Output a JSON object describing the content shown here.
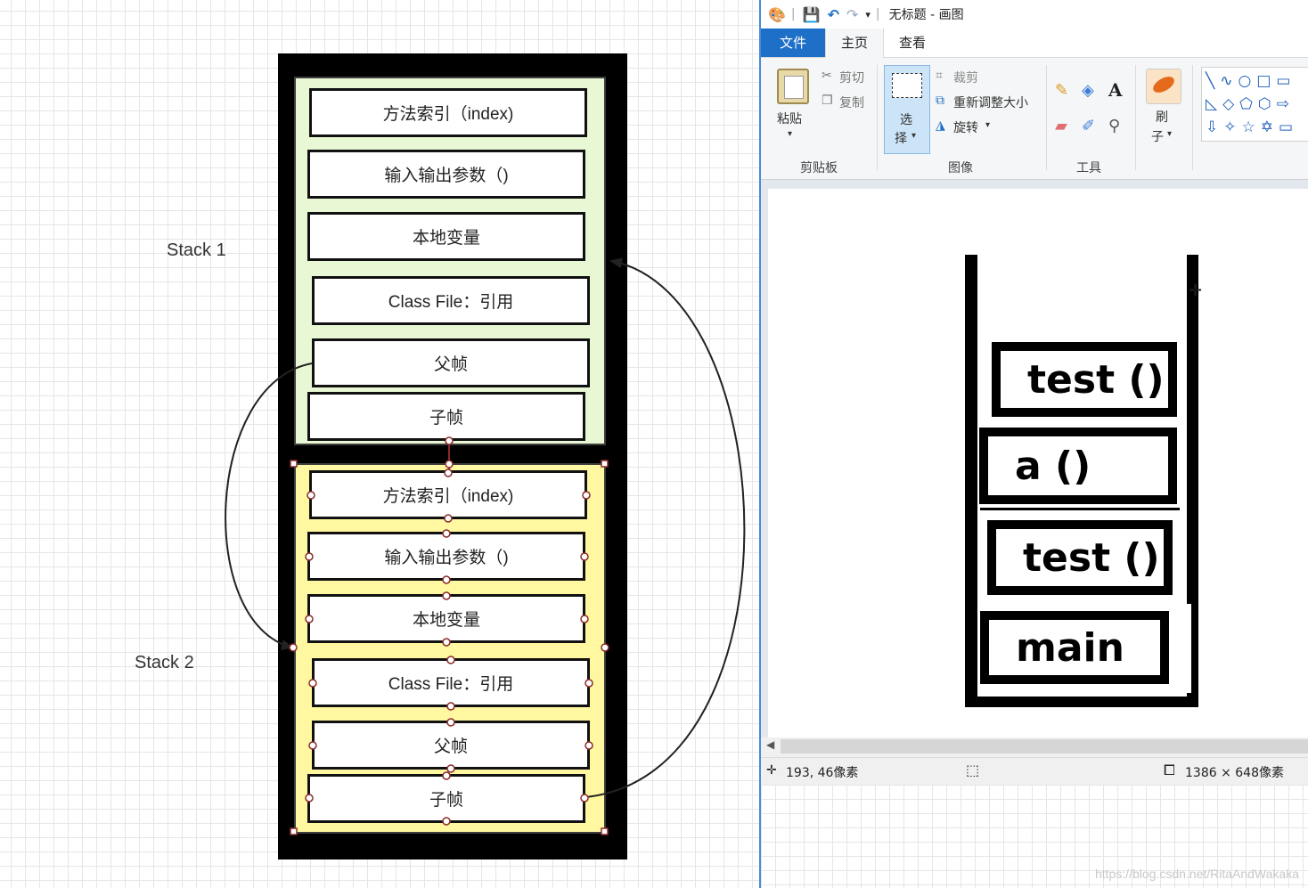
{
  "diagram": {
    "stack1_label": "Stack 1",
    "stack2_label": "Stack 2",
    "stack1_frames": [
      "方法索引（index)",
      "输入输出参数（)",
      "本地变量",
      "Class File：引用",
      "父帧",
      "子帧"
    ],
    "stack2_frames": [
      "方法索引（index)",
      "输入输出参数（)",
      "本地变量",
      "Class File：引用",
      "父帧",
      "子帧"
    ],
    "panel_colors": {
      "stack1": "#e9f8d4",
      "stack2": "#fff8a0"
    }
  },
  "paint": {
    "window_title": "无标题 - 画图",
    "tabs": {
      "file": "文件",
      "home": "主页",
      "view": "查看"
    },
    "clipboard": {
      "paste": "粘贴",
      "cut": "剪切",
      "copy": "复制",
      "group": "剪贴板"
    },
    "image": {
      "select_1": "选",
      "select_2": "择",
      "crop": "裁剪",
      "resize": "重新调整大小",
      "rotate": "旋转",
      "group": "图像"
    },
    "tools": {
      "group": "工具"
    },
    "brushes": {
      "label_1": "刷",
      "label_2": "子"
    },
    "drawing_frames": [
      "test  ()",
      "a  ()",
      "test  ()",
      "main"
    ],
    "status": {
      "cursor_pos": "193, 46像素",
      "image_size": "1386 × 648像素"
    }
  },
  "watermark": "https://blog.csdn.net/RitaAndWakaka"
}
